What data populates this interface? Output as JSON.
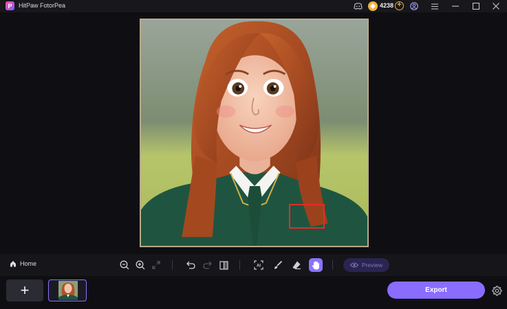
{
  "app": {
    "title": "HitPaw FotorPea",
    "logo_letter": "P"
  },
  "titlebar": {
    "coin_count": "4238",
    "icons": [
      "discord-icon",
      "coin-icon",
      "add-coins-icon",
      "account-icon",
      "menu-icon",
      "minimize-icon",
      "maximize-icon",
      "close-icon"
    ]
  },
  "toolbar": {
    "home_label": "Home",
    "preview_label": "Preview",
    "tools": [
      "zoom-out-icon",
      "zoom-in-icon",
      "fit-screen-icon",
      "undo-icon",
      "redo-icon",
      "compare-icon",
      "ai-select-icon",
      "brush-icon",
      "eraser-icon",
      "hand-icon"
    ]
  },
  "bottom": {
    "add_label": "+",
    "export_label": "Export"
  },
  "colors": {
    "accent": "#8a6cff",
    "selection": "#e52a2a",
    "coin": "#f2b33a"
  }
}
